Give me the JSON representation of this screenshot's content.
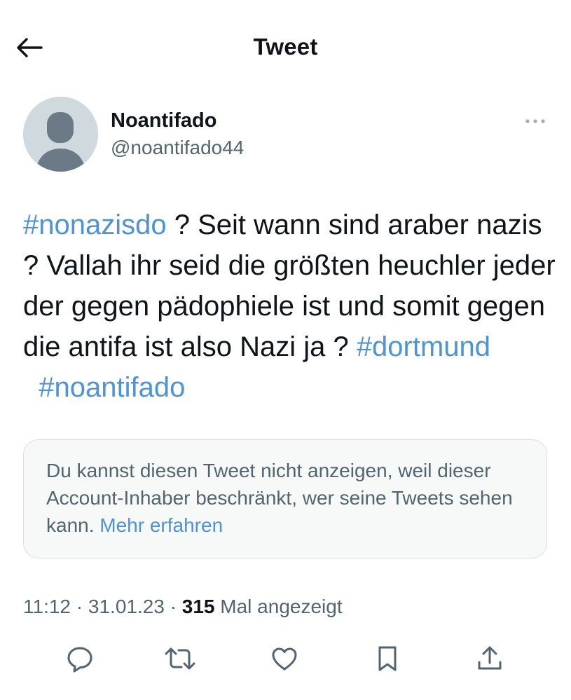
{
  "header": {
    "title": "Tweet",
    "back_icon": "arrow-left-icon"
  },
  "author": {
    "name": "Noantifado",
    "handle": "@noantifado44",
    "avatar_icon": "default-avatar-icon"
  },
  "tweet": {
    "segments": [
      {
        "text": "#nonazisdo",
        "type": "hashtag"
      },
      {
        "text": " ? Seit wann sind araber nazis ? Vallah ihr seid die größten heuchler jeder der gegen pädophiele ist und somit gegen die antifa ist also Nazi ja ? ",
        "type": "text"
      },
      {
        "text": "#dortmund",
        "type": "hashtag"
      },
      {
        "text": "  ",
        "type": "text"
      },
      {
        "text": "#noantifado",
        "type": "hashtag"
      }
    ]
  },
  "notice": {
    "text": "Du kannst diesen Tweet nicht anzeigen, weil dieser Account-Inhaber beschränkt, wer seine Tweets sehen kann.",
    "link_text": "Mehr erfahren"
  },
  "meta": {
    "time": "11:12",
    "separator": " · ",
    "date": "31.01.23",
    "views_count": "315",
    "views_label": "Mal angezeigt"
  },
  "actions": [
    {
      "name": "reply",
      "icon": "reply-icon"
    },
    {
      "name": "retweet",
      "icon": "retweet-icon"
    },
    {
      "name": "like",
      "icon": "heart-icon"
    },
    {
      "name": "bookmark",
      "icon": "bookmark-icon"
    },
    {
      "name": "share",
      "icon": "share-icon"
    }
  ],
  "colors": {
    "link": "#4d93d6",
    "text": "#0f1419",
    "secondary": "#536471",
    "avatar_bg": "#cfd9de",
    "avatar_fg": "#6b7a86",
    "notice_bg": "#f7f9f9",
    "notice_border": "#d8dfe4"
  }
}
